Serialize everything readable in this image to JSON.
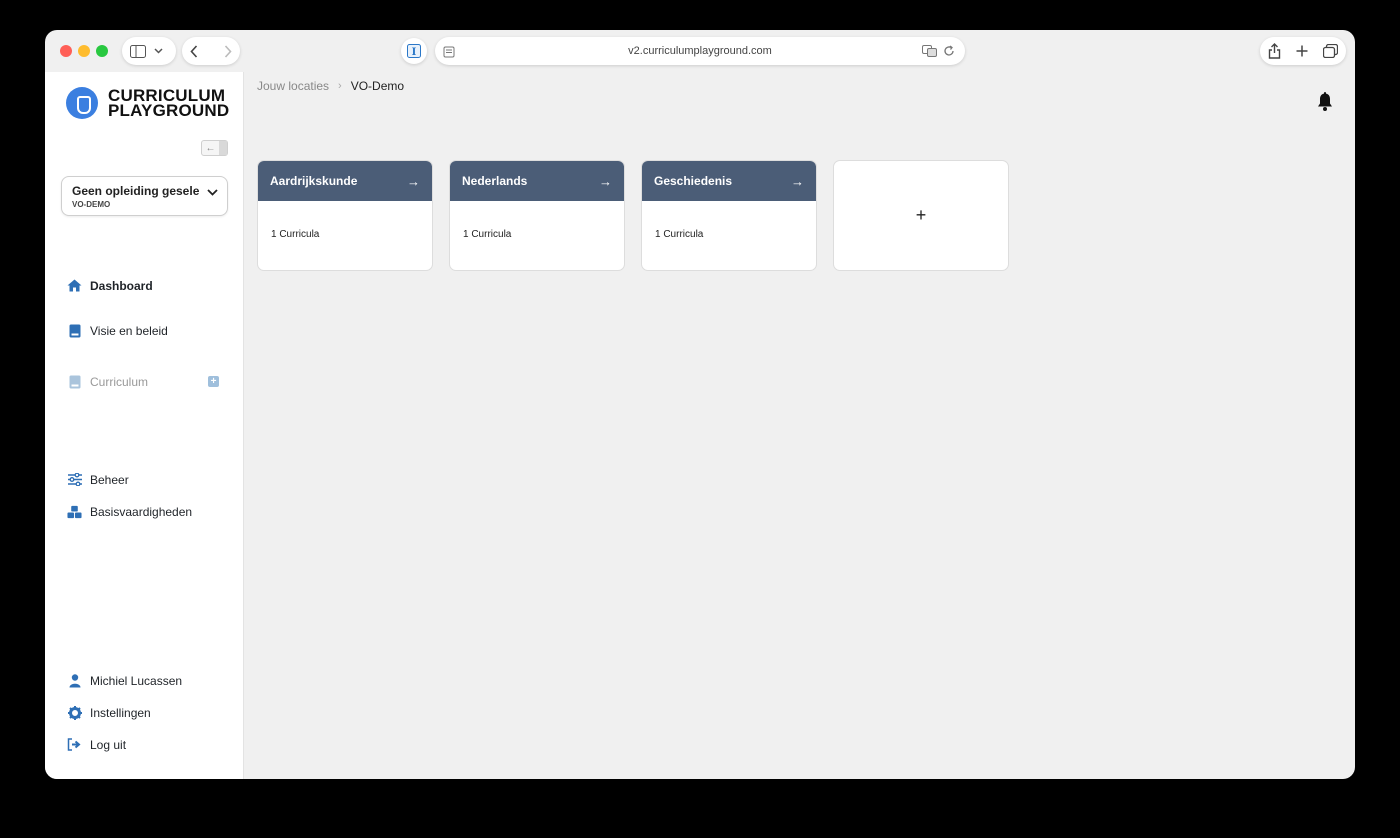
{
  "browser": {
    "url": "v2.curriculumplayground.com",
    "icons": [
      "sidebar-icon",
      "chevron-down-icon",
      "back-icon",
      "forward-icon",
      "extension-icon",
      "reader-icon",
      "translate-icon",
      "reload-icon",
      "share-icon",
      "new-tab-icon",
      "tabs-icon"
    ]
  },
  "sidebar": {
    "logo_line1": "CURRICULUM",
    "logo_line2": "PLAYGROUND",
    "selector": {
      "title": "Geen opleiding gesele...",
      "subtitle": "VO-DEMO"
    },
    "nav": [
      {
        "label": "Dashboard",
        "icon": "home-icon"
      },
      {
        "label": "Visie en beleid",
        "icon": "book-icon"
      },
      {
        "label": "Curriculum",
        "icon": "book-icon"
      },
      {
        "label": "Beheer",
        "icon": "sliders-icon"
      },
      {
        "label": "Basisvaardigheden",
        "icon": "cubes-icon"
      }
    ],
    "footer": [
      {
        "label": "Michiel Lucassen",
        "icon": "user-icon"
      },
      {
        "label": "Instellingen",
        "icon": "gear-icon"
      },
      {
        "label": "Log uit",
        "icon": "logout-icon"
      }
    ]
  },
  "breadcrumb": {
    "item1": "Jouw locaties",
    "item2": "VO-Demo"
  },
  "cards": [
    {
      "title": "Aardrijkskunde",
      "count": "1 Curricula"
    },
    {
      "title": "Nederlands",
      "count": "1 Curricula"
    },
    {
      "title": "Geschiedenis",
      "count": "1 Curricula"
    }
  ],
  "add_card_label": "+",
  "colors": {
    "accent": "#2e6fb5",
    "card_header": "#4b5d77",
    "logo": "#3b7fe0"
  }
}
